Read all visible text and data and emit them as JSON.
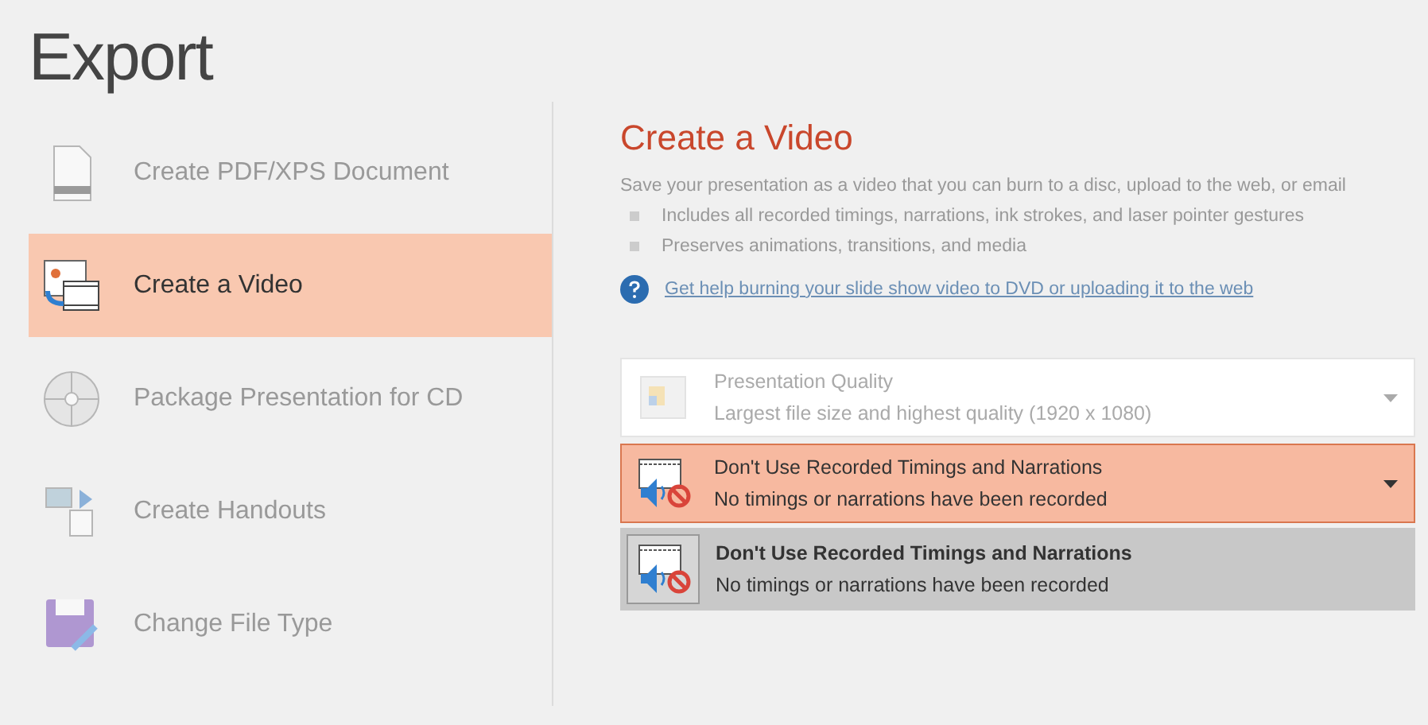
{
  "title": "Export",
  "sidebar": {
    "items": [
      {
        "label": "Create PDF/XPS Document",
        "kind": "document",
        "selected": false
      },
      {
        "label": "Create a Video",
        "kind": "video",
        "selected": true
      },
      {
        "label": "Package Presentation for CD",
        "kind": "disc",
        "selected": false
      },
      {
        "label": "Create Handouts",
        "kind": "handouts",
        "selected": false
      },
      {
        "label": "Change File Type",
        "kind": "save",
        "selected": false
      }
    ]
  },
  "content": {
    "heading": "Create a Video",
    "description": "Save your presentation as a video that you can burn to a disc, upload to the web, or email",
    "bullets": [
      "Includes all recorded timings, narrations, ink strokes, and laser pointer gestures",
      "Preserves animations, transitions, and media"
    ],
    "help_link": "Get help burning your slide show video to DVD or uploading it to the web",
    "dropdowns": [
      {
        "kind": "quality",
        "title": "Presentation Quality",
        "subtitle": "Largest file size and highest quality (1920 x 1080)",
        "disabled": true,
        "expanded": false
      },
      {
        "kind": "timings",
        "title": "Don't Use Recorded Timings and Narrations",
        "subtitle": "No timings or narrations have been recorded",
        "disabled": false,
        "expanded": true
      }
    ],
    "menu": [
      {
        "kind": "timings",
        "title": "Don't Use Recorded Timings and Narrations",
        "subtitle": "No timings or narrations have been recorded",
        "selected": true
      }
    ]
  }
}
